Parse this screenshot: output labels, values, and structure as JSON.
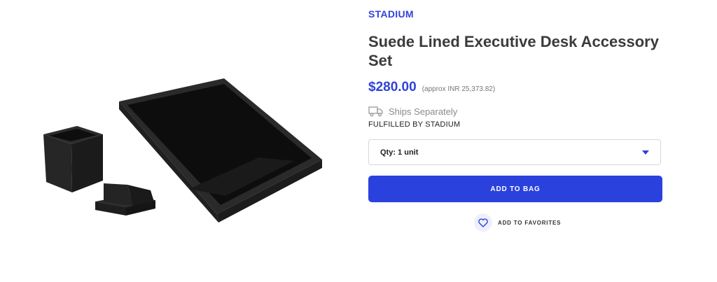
{
  "product": {
    "brand": "STADIUM",
    "title": "Suede Lined Executive Desk Accessory Set",
    "price": "$280.00",
    "price_approx": "(approx INR 25,373.82)",
    "shipping": "Ships Separately",
    "fulfilled_by": "FULFILLED BY STADIUM",
    "image_alt": "Black leather desk tray, pen cup and card holder"
  },
  "qty_select": {
    "selected": "Qty: 1 unit"
  },
  "actions": {
    "add_to_bag": "ADD TO BAG",
    "add_to_favorites": "ADD TO FAVORITES"
  },
  "colors": {
    "accent": "#2b41de",
    "brand_text": "#2f43d9"
  },
  "icons": {
    "shipping": "truck-icon",
    "dropdown": "chevron-down-icon",
    "favorite": "heart-icon"
  }
}
